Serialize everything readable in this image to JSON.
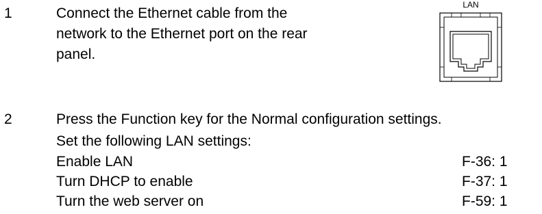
{
  "step1": {
    "number": "1",
    "lines": [
      "Connect the Ethernet cable from the",
      "network to the Ethernet port on the rear",
      "panel."
    ]
  },
  "lan_figure": {
    "label": "LAN",
    "icon": "ethernet-port-icon"
  },
  "step2": {
    "number": "2",
    "text": "Press the Function key for the Normal configuration settings.",
    "settings_intro": "Set the following LAN settings:",
    "settings": [
      {
        "name": "Enable LAN",
        "code": "F-36: 1"
      },
      {
        "name": "Turn DHCP to enable",
        "code": "F-37: 1"
      },
      {
        "name": "Turn the web server on",
        "code": "F-59: 1"
      }
    ]
  }
}
